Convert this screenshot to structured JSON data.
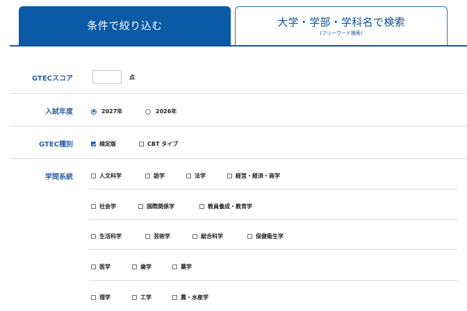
{
  "tabs": {
    "filter_label": "条件で絞り込む",
    "search_label": "大学・学部・学科名で検索",
    "search_sub": "(フリーワード検索)"
  },
  "gtec_score": {
    "label": "GTECスコア",
    "value": "",
    "unit": "点"
  },
  "exam_year": {
    "label": "入試年度",
    "options": [
      {
        "label": "2027年",
        "selected": true
      },
      {
        "label": "2026年",
        "selected": false
      }
    ]
  },
  "gtec_type": {
    "label": "GTEC種別",
    "options": [
      {
        "label": "検定版",
        "checked": true
      },
      {
        "label": "CBT タイプ",
        "checked": false
      }
    ]
  },
  "fields": {
    "label": "学問系統",
    "rows": [
      [
        {
          "label": "人文科学"
        },
        {
          "label": "語学"
        },
        {
          "label": "法学"
        },
        {
          "label": "経営・経済・商学"
        }
      ],
      [
        {
          "label": "社会学"
        },
        {
          "label": "国際関係学"
        },
        {
          "label": "教員養成・教育学"
        }
      ],
      [
        {
          "label": "生活科学"
        },
        {
          "label": "芸術学"
        },
        {
          "label": "総合科学"
        },
        {
          "label": "保健衛生学"
        }
      ],
      [
        {
          "label": "医学"
        },
        {
          "label": "歯学"
        },
        {
          "label": "薬学"
        }
      ],
      [
        {
          "label": "理学"
        },
        {
          "label": "工学"
        },
        {
          "label": "農・水産学"
        }
      ]
    ]
  },
  "colors": {
    "brand_blue": "#0a5aa6",
    "label_blue": "#2a5ea2",
    "checkbox_blue": "#1a5ec4"
  }
}
